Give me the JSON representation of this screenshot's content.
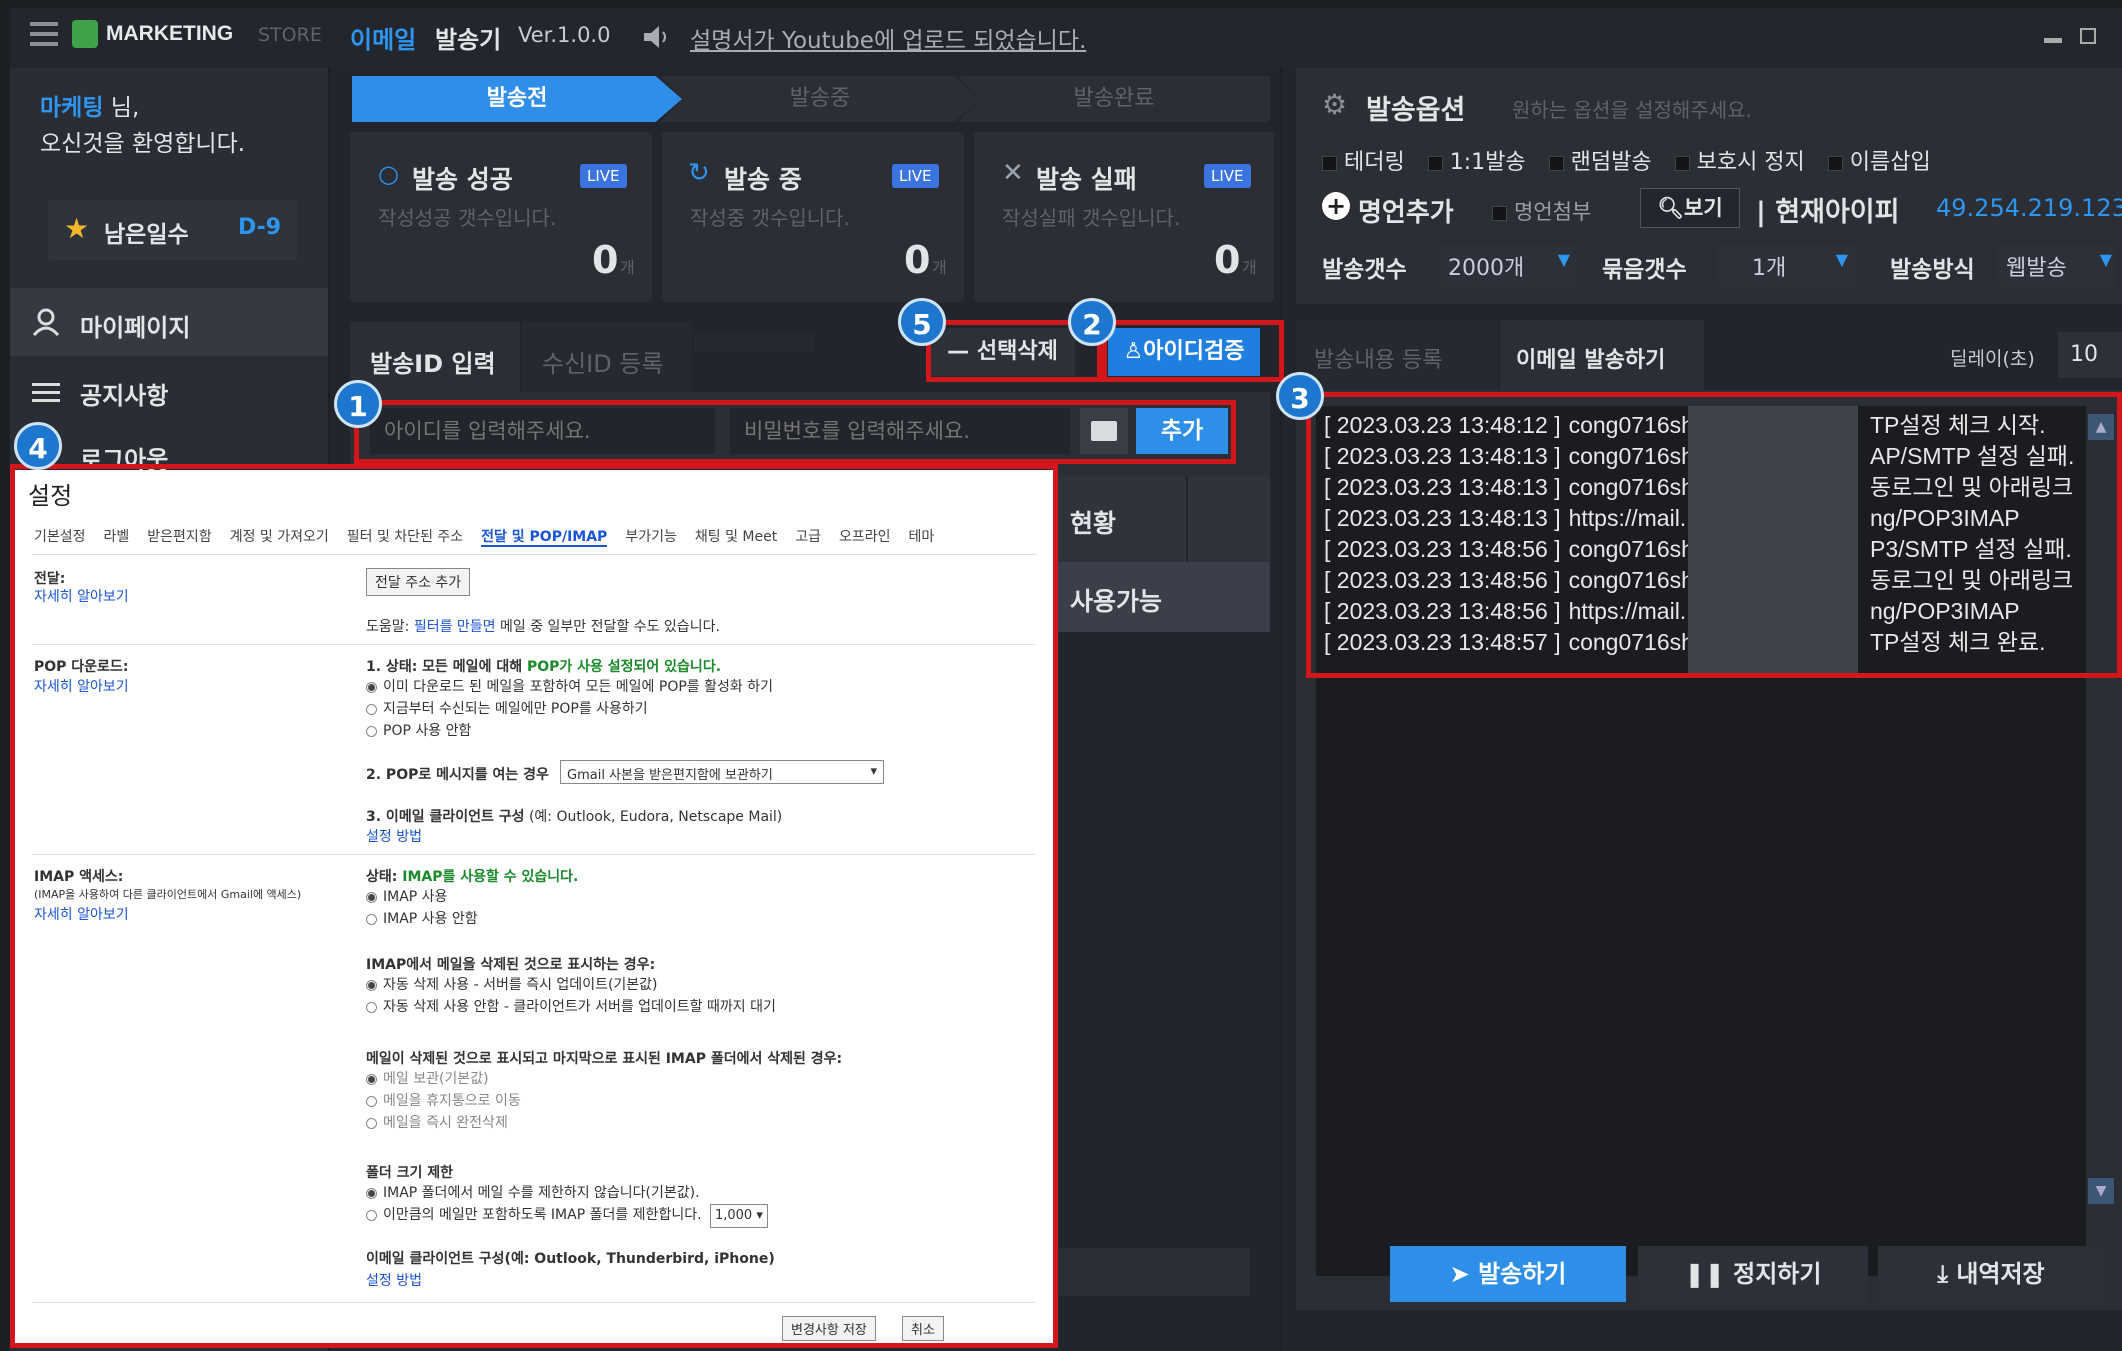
{
  "titlebar": {
    "menu_icon": "hamburger-icon",
    "logo_icon": "store-bag-icon",
    "brand": "MARKETING",
    "brand_suffix": "STORE",
    "app_title_1": "이메일",
    "app_title_2": "발송기",
    "version": "Ver.1.0.0",
    "speaker_icon": "speaker-icon",
    "notice": "설명서가 Youtube에 업로드 되었습니다.",
    "win_min": "minimize-icon",
    "win_max": "maximize-icon"
  },
  "sidebar": {
    "user_name": "마케팅",
    "user_suffix": "님,",
    "welcome": "오신것을 환영합니다.",
    "days_label": "남은일수",
    "days_value": "D-9",
    "menu": [
      {
        "label": "마이페이지",
        "icon": "user-icon"
      },
      {
        "label": "공지사항",
        "icon": "list-icon"
      },
      {
        "label": "로그아웃",
        "icon": "logout-icon"
      }
    ]
  },
  "steps": {
    "items": [
      "발송전",
      "발송중",
      "발송완료"
    ],
    "active": 0
  },
  "stats": [
    {
      "title": "발송 성공",
      "desc": "작성성공 갯수입니다.",
      "value": "0",
      "unit": "개",
      "live": "LIVE",
      "icon": "circle-icon"
    },
    {
      "title": "발송 중",
      "desc": "작성중 갯수입니다.",
      "value": "0",
      "unit": "개",
      "live": "LIVE",
      "icon": "refresh-icon"
    },
    {
      "title": "발송 실패",
      "desc": "작성실패 갯수입니다.",
      "value": "0",
      "unit": "개",
      "live": "LIVE",
      "icon": "x-icon"
    }
  ],
  "id_tabs": [
    "발송ID 입력",
    "수신ID 등록"
  ],
  "buttons": {
    "delete": "선택삭제",
    "verify": "아이디검증",
    "add": "추가",
    "send": "발송하기",
    "stop": "정지하기",
    "save_log": "내역저장",
    "view": "보기"
  },
  "inputs": {
    "id_placeholder": "아이디를 입력해주세요.",
    "pw_placeholder": "비밀번호를 입력해주세요."
  },
  "table": {
    "header_frag": "현황",
    "row_frag": "사용가능"
  },
  "options": {
    "title": "발송옵션",
    "subtitle": "원하는 옵션을 설정해주세요.",
    "checks": [
      "테더링",
      "1:1발송",
      "랜덤발송",
      "보호시 정지",
      "이름삽입"
    ],
    "add_quote": "명언추가",
    "attach_quote": "명언첨부",
    "current_ip_label": "현재아이피",
    "current_ip": "49.254.219.123",
    "count_label": "발송갯수",
    "count_value": "2000개",
    "bundle_label": "묶음갯수",
    "bundle_value": "1개",
    "method_label": "발송방식",
    "method_value": "웹발송"
  },
  "right_tabs": [
    "발송내용 등록",
    "이메일 발송하기"
  ],
  "delay": {
    "label": "딜레이(초)",
    "value": "10"
  },
  "log": [
    {
      "ts": "[ 2023.03.23 13:48:12 ]",
      "who": "cong0716sh",
      "msg": "TP설정 체크 시작."
    },
    {
      "ts": "[ 2023.03.23 13:48:13 ]",
      "who": "cong0716sh",
      "msg": "AP/SMTP 설정 실패."
    },
    {
      "ts": "[ 2023.03.23 13:48:13 ]",
      "who": "cong0716sh",
      "msg": "동로그인 및 아래링크"
    },
    {
      "ts": "[ 2023.03.23 13:48:13 ]",
      "who": "https://mail.",
      "msg": "ng/POP3IMAP"
    },
    {
      "ts": "[ 2023.03.23 13:48:56 ]",
      "who": "cong0716sh",
      "msg": "P3/SMTP 설정 실패."
    },
    {
      "ts": "[ 2023.03.23 13:48:56 ]",
      "who": "cong0716sh",
      "msg": "동로그인 및 아래링크"
    },
    {
      "ts": "[ 2023.03.23 13:48:56 ]",
      "who": "https://mail.",
      "msg": "ng/POP3IMAP"
    },
    {
      "ts": "[ 2023.03.23 13:48:57 ]",
      "who": "cong0716sh",
      "msg": "TP설정 체크 완료."
    }
  ],
  "callouts": [
    "1",
    "2",
    "3",
    "4",
    "5"
  ],
  "gmail": {
    "title": "설정",
    "tabs": [
      "기본설정",
      "라벨",
      "받은편지함",
      "계정 및 가져오기",
      "필터 및 차단된 주소",
      "전달 및 POP/IMAP",
      "부가기능",
      "채팅 및 Meet",
      "고급",
      "오프라인",
      "테마"
    ],
    "active_tab": 5,
    "fwd_label": "전달:",
    "learn_more": "자세히 알아보기",
    "fwd_button": "전달 주소 추가",
    "fwd_tip_prefix": "도움말:",
    "fwd_tip_link": "필터를 만들면",
    "fwd_tip_rest": "메일 중 일부만 전달할 수도 있습니다.",
    "pop_label": "POP 다운로드:",
    "pop_status_prefix": "1. 상태:",
    "pop_status_text": "모든 메일에 대해",
    "pop_status_green": "POP가 사용 설정되어 있습니다.",
    "pop_opts": [
      "이미 다운로드 된 메일을 포함하여 모든 메일에 POP를 활성화 하기",
      "지금부터 수신되는 메일에만 POP를 사용하기",
      "POP 사용 안함"
    ],
    "pop2_label": "2. POP로 메시지를 여는 경우",
    "pop2_value": "Gmail 사본을 받은편지함에 보관하기",
    "pop3_label": "3. 이메일 클라이언트 구성",
    "pop3_note": "(예: Outlook, Eudora, Netscape Mail)",
    "setup_link": "설정 방법",
    "imap_label": "IMAP 액세스:",
    "imap_note": "(IMAP을 사용하여 다른 클라이언트에서 Gmail에 액세스)",
    "imap_status_prefix": "상태:",
    "imap_status_green": "IMAP를 사용할 수 있습니다.",
    "imap_opts": [
      "IMAP 사용",
      "IMAP 사용 안함"
    ],
    "imap_del_label": "IMAP에서 메일을 삭제된 것으로 표시하는 경우:",
    "imap_del_opts": [
      "자동 삭제 사용 - 서버를 즉시 업데이트(기본값)",
      "자동 삭제 사용 안함 - 클라이언트가 서버를 업데이트할 때까지 대기"
    ],
    "imap_exp_label": "메일이 삭제된 것으로 표시되고 마지막으로 표시된 IMAP 폴더에서 삭제된 경우:",
    "imap_exp_opts": [
      "메일 보관(기본값)",
      "메일을 휴지통으로 이동",
      "메일을 즉시 완전삭제"
    ],
    "folder_label": "폴더 크기 제한",
    "folder_opts": [
      "IMAP 폴더에서 메일 수를 제한하지 않습니다(기본값).",
      "이만큼의 메일만 포함하도록 IMAP 폴더를 제한합니다."
    ],
    "folder_value": "1,000",
    "client_label": "이메일 클라이언트 구성(예: Outlook, Thunderbird, iPhone)",
    "save_btn": "변경사항 저장",
    "cancel_btn": "취소"
  }
}
